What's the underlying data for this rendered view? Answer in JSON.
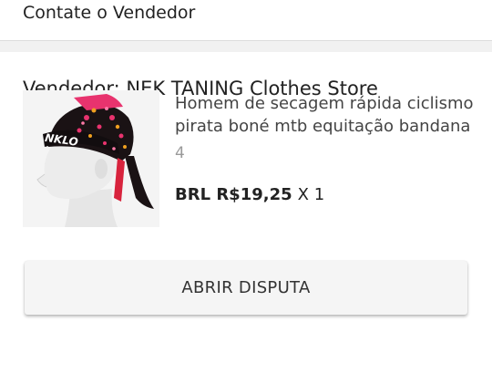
{
  "contact": {
    "label": "Contate o Vendedor"
  },
  "seller": {
    "label": "Vendedor: NEK TANING Clothes Store"
  },
  "product": {
    "title": "Homem de secagem rápida ciclismo pirata boné mtb equitação bandana",
    "variant": "4",
    "price": "BRL R$19,25",
    "quantity": "X 1",
    "image_text": "NKLO"
  },
  "actions": {
    "dispute_label": "ABRIR DISPUTA"
  },
  "colors": {
    "divider": "#f1f1f1",
    "button_bg": "#f5f5f5",
    "bandana_base": "#1a1214",
    "bandana_accent": "#e8336e",
    "ribbon": "#d8233d"
  }
}
